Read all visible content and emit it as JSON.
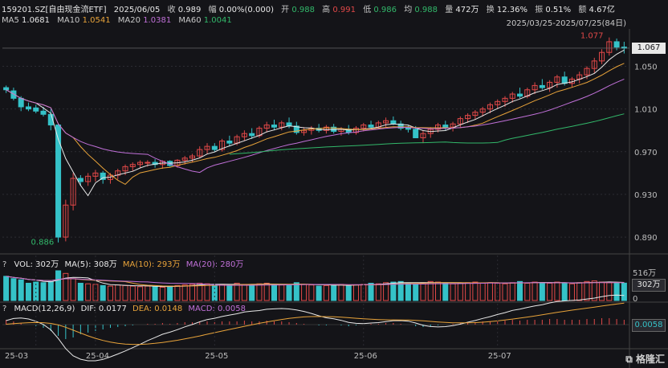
{
  "header": {
    "symbol": "159201.SZ[自由现金流ETF]",
    "date": "2025/06/05",
    "close_label": "收",
    "close": "0.989",
    "change_label": "幅",
    "change": "0.00%(0.000)",
    "open_label": "开",
    "open": "0.988",
    "high_label": "高",
    "high": "0.991",
    "low_label": "低",
    "low": "0.986",
    "avg_label": "均",
    "avg": "0.988",
    "volume_label": "量",
    "volume": "472万",
    "turnover_label": "换",
    "turnover": "12.36%",
    "amplitude_label": "振",
    "amplitude": "0.51%",
    "amount_label": "额",
    "amount": "4.67亿",
    "range": "2025/03/25-2025/07/25(84日)"
  },
  "ma_legend": {
    "ma5_label": "MA5",
    "ma5": "1.0681",
    "ma10_label": "MA10",
    "ma10": "1.0541",
    "ma20_label": "MA20",
    "ma20": "1.0381",
    "ma60_label": "MA60",
    "ma60": "1.0041"
  },
  "vol_legend": {
    "q": "?",
    "vol": "VOL: 302万",
    "ma5": "MA(5): 308万",
    "ma10": "MA(10): 293万",
    "ma20": "MA(20): 280万"
  },
  "macd_legend": {
    "q": "?",
    "macd": "MACD(12,26,9)",
    "dif": "DIF: 0.0177",
    "dea": "DEA: 0.0148",
    "macd_val": "MACD: 0.0058"
  },
  "colors": {
    "up": "#e04848",
    "down": "#35c2c8",
    "ma5": "#e8e8e8",
    "ma10": "#e8a33a",
    "ma20": "#c070d8",
    "ma60": "#32b86a"
  },
  "watermark": "格隆汇",
  "chart_data": {
    "type": "candlestick",
    "ylim": [
      0.875,
      1.085
    ],
    "yticks": [
      "1.050",
      "1.010",
      "0.970",
      "0.930",
      "0.890"
    ],
    "current_price": "1.067",
    "max_label": "1.077",
    "min_label": "0.886",
    "x_labels": [
      "25-03",
      "25-04",
      "25-05",
      "25-06",
      "25-07"
    ],
    "vol_ticks": [
      "516万",
      "302万",
      "0"
    ],
    "macd_tick": "0.0058",
    "candles": [
      [
        1.03,
        1.032,
        1.025,
        1.028
      ],
      [
        1.027,
        1.03,
        1.018,
        1.02
      ],
      [
        1.02,
        1.022,
        1.008,
        1.012
      ],
      [
        1.012,
        1.016,
        1.008,
        1.01
      ],
      [
        1.011,
        1.014,
        1.006,
        1.008
      ],
      [
        1.008,
        1.012,
        1.003,
        1.005
      ],
      [
        1.005,
        1.01,
        0.99,
        0.995
      ],
      [
        0.995,
        0.996,
        0.885,
        0.89
      ],
      [
        0.89,
        0.925,
        0.886,
        0.92
      ],
      [
        0.92,
        0.95,
        0.915,
        0.945
      ],
      [
        0.945,
        0.948,
        0.938,
        0.942
      ],
      [
        0.942,
        0.95,
        0.938,
        0.947
      ],
      [
        0.947,
        0.953,
        0.942,
        0.95
      ],
      [
        0.95,
        0.952,
        0.94,
        0.944
      ],
      [
        0.944,
        0.95,
        0.94,
        0.948
      ],
      [
        0.948,
        0.954,
        0.944,
        0.952
      ],
      [
        0.952,
        0.958,
        0.948,
        0.956
      ],
      [
        0.956,
        0.96,
        0.952,
        0.958
      ],
      [
        0.958,
        0.962,
        0.955,
        0.96
      ],
      [
        0.96,
        0.962,
        0.956,
        0.96
      ],
      [
        0.96,
        0.963,
        0.955,
        0.958
      ],
      [
        0.958,
        0.962,
        0.954,
        0.961
      ],
      [
        0.961,
        0.962,
        0.956,
        0.957
      ],
      [
        0.957,
        0.963,
        0.955,
        0.962
      ],
      [
        0.962,
        0.966,
        0.958,
        0.964
      ],
      [
        0.964,
        0.968,
        0.96,
        0.966
      ],
      [
        0.966,
        0.975,
        0.964,
        0.972
      ],
      [
        0.972,
        0.978,
        0.968,
        0.975
      ],
      [
        0.975,
        0.978,
        0.97,
        0.972
      ],
      [
        0.972,
        0.982,
        0.97,
        0.98
      ],
      [
        0.98,
        0.985,
        0.975,
        0.978
      ],
      [
        0.978,
        0.986,
        0.976,
        0.984
      ],
      [
        0.984,
        0.99,
        0.98,
        0.987
      ],
      [
        0.987,
        0.992,
        0.982,
        0.985
      ],
      [
        0.985,
        0.994,
        0.983,
        0.992
      ],
      [
        0.992,
        0.998,
        0.988,
        0.995
      ],
      [
        0.995,
        1.0,
        0.99,
        0.993
      ],
      [
        0.993,
        0.999,
        0.99,
        0.997
      ],
      [
        0.997,
        1.002,
        0.992,
        0.994
      ],
      [
        0.994,
        0.998,
        0.986,
        0.988
      ],
      [
        0.988,
        0.993,
        0.985,
        0.99
      ],
      [
        0.99,
        0.994,
        0.986,
        0.992
      ],
      [
        0.992,
        0.996,
        0.988,
        0.99
      ],
      [
        0.99,
        0.995,
        0.987,
        0.993
      ],
      [
        0.993,
        0.996,
        0.987,
        0.989
      ],
      [
        0.989,
        0.993,
        0.985,
        0.991
      ],
      [
        0.991,
        0.995,
        0.986,
        0.988
      ],
      [
        0.988,
        0.994,
        0.986,
        0.992
      ],
      [
        0.992,
        0.997,
        0.989,
        0.995
      ],
      [
        0.995,
        0.999,
        0.991,
        0.993
      ],
      [
        0.993,
        0.999,
        0.991,
        0.997
      ],
      [
        0.997,
        1.002,
        0.993,
        0.999
      ],
      [
        0.999,
        1.003,
        0.995,
        0.996
      ],
      [
        0.996,
        0.999,
        0.99,
        0.992
      ],
      [
        0.992,
        0.995,
        0.988,
        0.991
      ],
      [
        0.991,
        0.994,
        0.985,
        0.983
      ],
      [
        0.983,
        0.99,
        0.978,
        0.987
      ],
      [
        0.987,
        0.993,
        0.983,
        0.991
      ],
      [
        0.991,
        0.997,
        0.988,
        0.995
      ],
      [
        0.995,
        0.999,
        0.99,
        0.993
      ],
      [
        0.993,
        0.998,
        0.989,
        0.996
      ],
      [
        0.996,
        1.003,
        0.993,
        1.001
      ],
      [
        1.001,
        1.006,
        0.997,
        1.004
      ],
      [
        1.004,
        1.009,
        1.0,
        1.007
      ],
      [
        1.007,
        1.012,
        1.003,
        1.01
      ],
      [
        1.01,
        1.016,
        1.006,
        1.014
      ],
      [
        1.014,
        1.019,
        1.01,
        1.017
      ],
      [
        1.017,
        1.022,
        1.012,
        1.02
      ],
      [
        1.02,
        1.026,
        1.016,
        1.024
      ],
      [
        1.024,
        1.03,
        1.02,
        1.022
      ],
      [
        1.022,
        1.03,
        1.02,
        1.028
      ],
      [
        1.028,
        1.035,
        1.024,
        1.032
      ],
      [
        1.032,
        1.038,
        1.028,
        1.03
      ],
      [
        1.03,
        1.037,
        1.026,
        1.035
      ],
      [
        1.035,
        1.042,
        1.03,
        1.04
      ],
      [
        1.04,
        1.045,
        1.032,
        1.034
      ],
      [
        1.034,
        1.04,
        1.03,
        1.038
      ],
      [
        1.038,
        1.045,
        1.034,
        1.042
      ],
      [
        1.042,
        1.05,
        1.038,
        1.048
      ],
      [
        1.048,
        1.058,
        1.044,
        1.055
      ],
      [
        1.055,
        1.066,
        1.052,
        1.063
      ],
      [
        1.063,
        1.077,
        1.06,
        1.073
      ],
      [
        1.073,
        1.076,
        1.065,
        1.068
      ],
      [
        1.068,
        1.073,
        1.062,
        1.067
      ]
    ],
    "volumes": [
      420,
      380,
      360,
      300,
      320,
      310,
      330,
      516,
      470,
      380,
      300,
      290,
      280,
      260,
      250,
      270,
      260,
      250,
      240,
      250,
      240,
      230,
      250,
      260,
      270,
      280,
      300,
      290,
      260,
      280,
      270,
      300,
      280,
      270,
      290,
      300,
      280,
      270,
      260,
      310,
      280,
      270,
      250,
      260,
      270,
      280,
      260,
      270,
      280,
      300,
      290,
      310,
      320,
      330,
      300,
      290,
      310,
      330,
      320,
      300,
      290,
      300,
      310,
      320,
      300,
      310,
      300,
      290,
      310,
      330,
      300,
      320,
      310,
      300,
      320,
      300,
      290,
      310,
      330,
      340,
      320,
      310,
      300,
      302
    ],
    "macd_hist": [
      0.006,
      0.004,
      0.002,
      0.0,
      -0.002,
      -0.004,
      -0.008,
      -0.014,
      -0.018,
      -0.016,
      -0.012,
      -0.01,
      -0.008,
      -0.006,
      -0.004,
      -0.003,
      -0.002,
      -0.001,
      0.0,
      0.001,
      0.001,
      0.002,
      0.001,
      0.002,
      0.003,
      0.003,
      0.004,
      0.004,
      0.003,
      0.004,
      0.004,
      0.004,
      0.005,
      0.004,
      0.004,
      0.005,
      0.004,
      0.004,
      0.003,
      0.002,
      0.001,
      0.0,
      -0.001,
      -0.001,
      0.0,
      -0.001,
      -0.002,
      -0.001,
      0.0,
      0.001,
      0.001,
      0.002,
      0.002,
      0.001,
      0.0,
      -0.002,
      -0.003,
      -0.002,
      -0.001,
      0.0,
      0.001,
      0.002,
      0.003,
      0.003,
      0.004,
      0.004,
      0.005,
      0.005,
      0.006,
      0.005,
      0.006,
      0.006,
      0.006,
      0.007,
      0.007,
      0.006,
      0.006,
      0.006,
      0.007,
      0.007,
      0.008,
      0.008,
      0.007,
      0.006
    ]
  }
}
